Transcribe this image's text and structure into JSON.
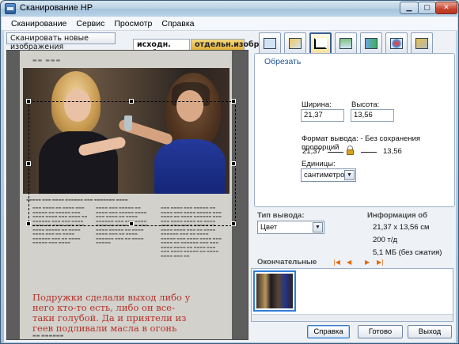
{
  "window": {
    "title": "Сканирование HP"
  },
  "menu": [
    "Сканирование",
    "Сервис",
    "Просмотр",
    "Справка"
  ],
  "preview": {
    "scan_new_label": "Сканировать новые изображения",
    "tab_original": "исходн. изобр.",
    "tab_separate": "отдельн.изобр.",
    "magazine_title": "Подружки сделали выход либо у него кто-то есть, либо он все-таки голубой. Да и приятели из геев подливали масла в огонь"
  },
  "tools": [
    {
      "name": "tool-scan-settings"
    },
    {
      "name": "tool-image-adjust"
    },
    {
      "name": "tool-crop",
      "active": true
    },
    {
      "name": "tool-resize"
    },
    {
      "name": "tool-rotate"
    },
    {
      "name": "tool-color"
    },
    {
      "name": "tool-sharpen"
    }
  ],
  "crop": {
    "heading": "Обрезать",
    "width_label": "Ширина:",
    "width_value": "21,37",
    "height_label": "Высота:",
    "height_value": "13,56",
    "output_format_text": "Формат вывода: - Без сохранения пропорций",
    "ratio_left": "21,37",
    "ratio_right": "13,56",
    "units_label": "Единицы:",
    "units_value": "сантиметров"
  },
  "output": {
    "type_label": "Тип вывода:",
    "type_value": "Цвет"
  },
  "info": {
    "title": "Информация об",
    "size": "21,37 x 13,56 см",
    "dpi": "200 т/д",
    "filesize": "5,1 МБ (без сжатия)"
  },
  "final": {
    "label": "Окончательные"
  },
  "buttons": {
    "help": "Справка",
    "done": "Готово",
    "exit": "Выход"
  },
  "colors": {
    "accent": "#2f7ed8",
    "heading": "#21569a",
    "nav_arrow": "#e36a0a",
    "active_tab": "#e2b23a"
  }
}
